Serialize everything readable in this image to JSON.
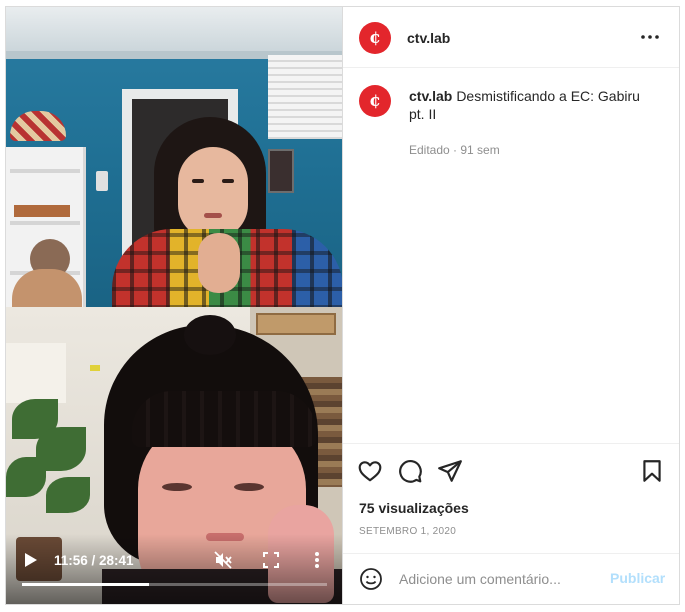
{
  "post": {
    "username": "ctv.lab",
    "avatar_glyph": "¢",
    "caption": "Desmistificando a EC: Gabiru pt. II",
    "edited_meta": "Editado · 91 sem",
    "views": "75 visualizações",
    "date": "SETEMBRO 1, 2020"
  },
  "video": {
    "time": "11:56 / 28:41",
    "progress_fraction": 0.416
  },
  "comment": {
    "placeholder": "Adicione um comentário...",
    "publish_label": "Publicar"
  },
  "icons": {
    "menu": "more-horizontal-icon",
    "like": "heart-icon",
    "comment": "comment-bubble-icon",
    "share": "paper-plane-icon",
    "save": "bookmark-icon",
    "play": "play-icon",
    "mute": "volume-muted-icon",
    "fullscreen": "fullscreen-icon",
    "video_more": "more-vertical-icon",
    "emoji": "emoji-icon"
  },
  "colors": {
    "brand": "#e3262c",
    "publish_disabled": "#b2dffc",
    "meta_text": "#8e8e8e"
  }
}
